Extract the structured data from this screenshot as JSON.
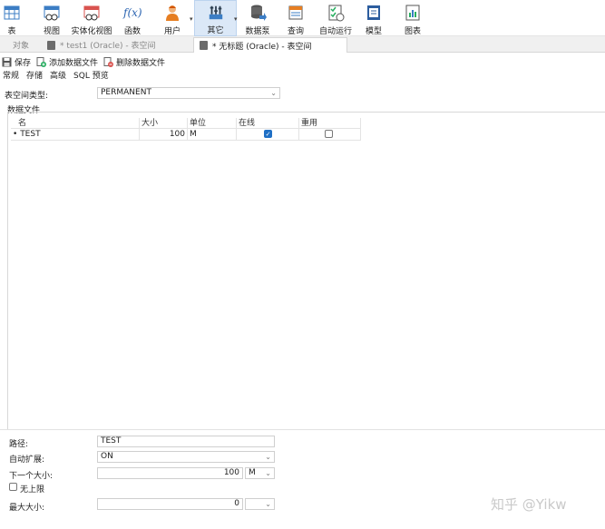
{
  "toolbar": {
    "items": [
      {
        "label": "表",
        "icon": "table-icon"
      },
      {
        "label": "视图",
        "icon": "view-icon"
      },
      {
        "label": "实体化视图",
        "icon": "materialized-view-icon"
      },
      {
        "label": "函数",
        "icon": "function-icon"
      },
      {
        "label": "用户",
        "icon": "user-icon"
      },
      {
        "label": "其它",
        "icon": "tools-icon"
      },
      {
        "label": "数据泵",
        "icon": "data-pump-icon"
      },
      {
        "label": "查询",
        "icon": "query-icon"
      },
      {
        "label": "自动运行",
        "icon": "automation-icon"
      },
      {
        "label": "模型",
        "icon": "model-icon"
      },
      {
        "label": "图表",
        "icon": "chart-icon"
      }
    ],
    "function_glyph": "f(x)"
  },
  "tabs": {
    "objects": "对象",
    "tab1": "* test1 (Oracle) - 表空间",
    "tab2": "* 无标题 (Oracle) - 表空间"
  },
  "actions": {
    "save": "保存",
    "add_datafile": "添加数据文件",
    "delete_datafile": "删除数据文件"
  },
  "subtabs": [
    "常规",
    "存储",
    "高级",
    "SQL 预览"
  ],
  "form": {
    "tablespace_type_label": "表空间类型:",
    "tablespace_type_value": "PERMANENT",
    "datafile_section": "数据文件",
    "columns": [
      "名",
      "大小",
      "单位",
      "在线",
      "重用"
    ],
    "rows": [
      {
        "marker": "•",
        "name": "TEST",
        "size": "100",
        "unit": "M",
        "online": true,
        "reuse": false
      }
    ],
    "path_label": "路径:",
    "path_value": "TEST",
    "autoextend_label": "自动扩展:",
    "autoextend_value": "ON",
    "next_size_label": "下一个大小:",
    "next_size_value": "100",
    "next_size_unit": "M",
    "unlimited_label": "无上限",
    "unlimited_checked": false,
    "max_size_label": "最大大小:",
    "max_size_value": "0",
    "max_size_unit": ""
  },
  "watermark": "知乎 @Yikw",
  "colors": {
    "active_tool_bg": "#dbe8f7",
    "checkbox_on": "#1f6fc5",
    "tab_bar_bg": "#f0f0f0"
  }
}
